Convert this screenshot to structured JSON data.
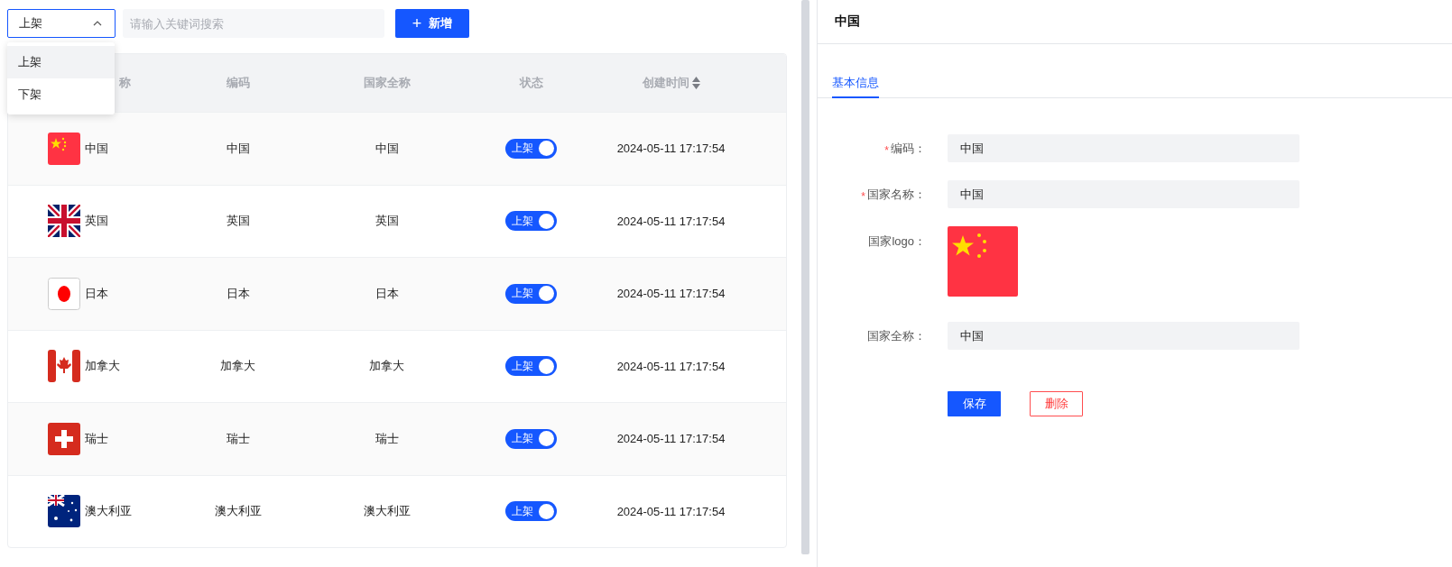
{
  "filter": {
    "value": "上架",
    "expanded": true,
    "options": [
      {
        "label": "上架",
        "selected": true
      },
      {
        "label": "下架",
        "selected": false
      }
    ]
  },
  "search": {
    "placeholder": "请输入关键词搜索"
  },
  "add_button": {
    "icon": "+",
    "label": "新增"
  },
  "table": {
    "columns": [
      "称",
      "编码",
      "国家全称",
      "状态",
      "创建时间"
    ],
    "rows": [
      {
        "kind": "cn",
        "name": "中国",
        "code": "中国",
        "full_name": "中国",
        "status": {
          "label": "上架",
          "on": true
        },
        "created": "2024-05-11 17:17:54"
      },
      {
        "kind": "gb",
        "name": "英国",
        "code": "英国",
        "full_name": "英国",
        "status": {
          "label": "上架",
          "on": true
        },
        "created": "2024-05-11 17:17:54"
      },
      {
        "kind": "jp",
        "name": "日本",
        "code": "日本",
        "full_name": "日本",
        "status": {
          "label": "上架",
          "on": true
        },
        "created": "2024-05-11 17:17:54"
      },
      {
        "kind": "ca",
        "name": "加拿大",
        "code": "加拿大",
        "full_name": "加拿大",
        "status": {
          "label": "上架",
          "on": true
        },
        "created": "2024-05-11 17:17:54"
      },
      {
        "kind": "ch",
        "name": "瑞士",
        "code": "瑞士",
        "full_name": "瑞士",
        "status": {
          "label": "上架",
          "on": true
        },
        "created": "2024-05-11 17:17:54"
      },
      {
        "kind": "au",
        "name": "澳大利亚",
        "code": "澳大利亚",
        "full_name": "澳大利亚",
        "status": {
          "label": "上架",
          "on": true
        },
        "created": "2024-05-11 17:17:54"
      }
    ]
  },
  "detail": {
    "title": "中国",
    "tabs": [
      {
        "label": "基本信息",
        "selected": true
      }
    ],
    "fields": [
      {
        "kind": "text",
        "required_mark": "*",
        "label": "编码：",
        "value": "中国"
      },
      {
        "kind": "text",
        "required_mark": "*",
        "label": "国家名称：",
        "value": "中国"
      },
      {
        "kind": "logo",
        "label": "国家logo："
      },
      {
        "kind": "text",
        "label": "国家全称：",
        "value": "中国"
      }
    ],
    "buttons": [
      {
        "kind": "primary",
        "label": "保存"
      },
      {
        "kind": "danger",
        "label": "删除"
      }
    ]
  }
}
